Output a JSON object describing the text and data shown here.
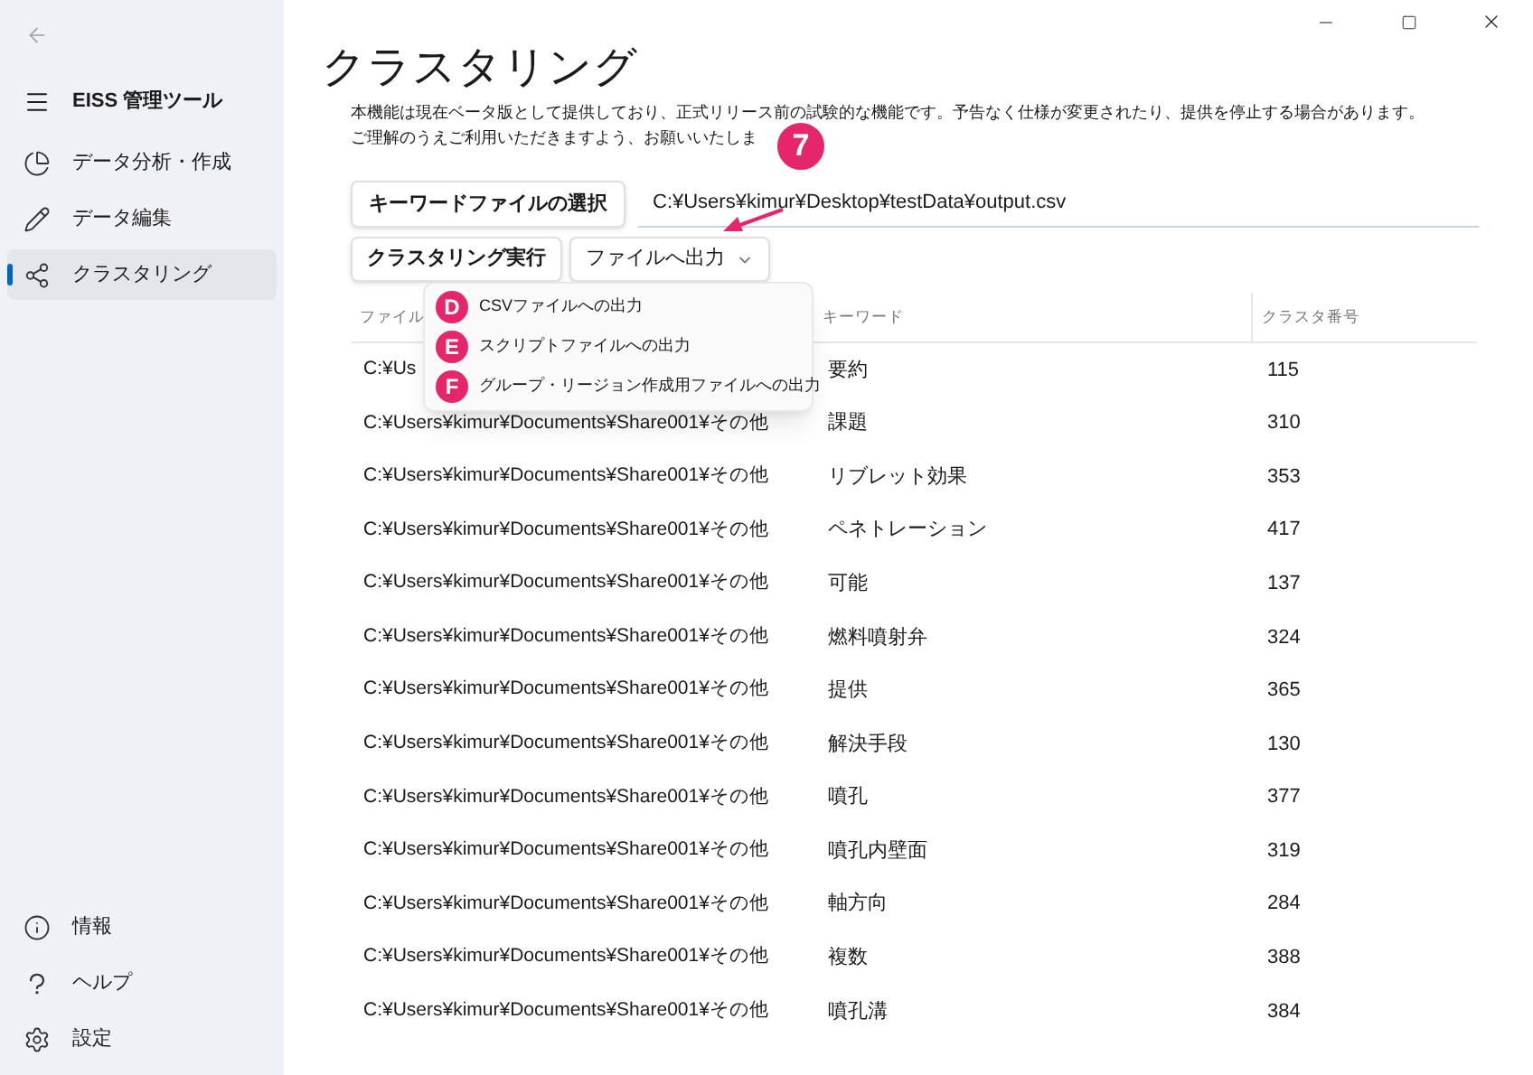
{
  "sidebar": {
    "app_title": "EISS 管理ツール",
    "nav_items": [
      {
        "kind": "chart",
        "label": "データ分析・作成",
        "selected": false
      },
      {
        "kind": "edit",
        "label": "データ編集",
        "selected": false
      },
      {
        "kind": "cluster",
        "label": "クラスタリング",
        "selected": true
      }
    ],
    "footer_items": [
      {
        "kind": "info",
        "label": "情報"
      },
      {
        "kind": "help",
        "label": "ヘルプ"
      },
      {
        "kind": "settings",
        "label": "設定"
      }
    ]
  },
  "page": {
    "title": "クラスタリング",
    "description": [
      "本機能は現在ベータ版として提供しており、正式リリース前の試験的な機能です。予告なく仕様が変更されたり、提供を停止する場合があります。",
      "ご理解のうえご利用いただきますよう、お願いいたしま"
    ],
    "select_button": "キーワードファイルの選択",
    "file_path": "C:¥Users¥kimur¥Desktop¥testData¥output.csv",
    "run_button": "クラスタリング実行",
    "export_button": "ファイルへ出力",
    "export_menu": [
      {
        "badge": "D",
        "label": "CSVファイルへの出力"
      },
      {
        "badge": "E",
        "label": "スクリプトファイルへの出力"
      },
      {
        "badge": "F",
        "label": "グループ・リージョン作成用ファイルへの出力"
      }
    ],
    "callout": "7"
  },
  "table": {
    "columns": [
      "ファイル",
      "キーワード",
      "クラスタ番号"
    ],
    "rows": [
      [
        "C:¥Us",
        "要約",
        "115"
      ],
      [
        "C:¥Users¥kimur¥Documents¥Share001¥その他",
        "課題",
        "310"
      ],
      [
        "C:¥Users¥kimur¥Documents¥Share001¥その他",
        "リブレット効果",
        "353"
      ],
      [
        "C:¥Users¥kimur¥Documents¥Share001¥その他",
        "ペネトレーション",
        "417"
      ],
      [
        "C:¥Users¥kimur¥Documents¥Share001¥その他",
        "可能",
        "137"
      ],
      [
        "C:¥Users¥kimur¥Documents¥Share001¥その他",
        "燃料噴射弁",
        "324"
      ],
      [
        "C:¥Users¥kimur¥Documents¥Share001¥その他",
        "提供",
        "365"
      ],
      [
        "C:¥Users¥kimur¥Documents¥Share001¥その他",
        "解決手段",
        "130"
      ],
      [
        "C:¥Users¥kimur¥Documents¥Share001¥その他",
        "噴孔",
        "377"
      ],
      [
        "C:¥Users¥kimur¥Documents¥Share001¥その他",
        "噴孔内壁面",
        "319"
      ],
      [
        "C:¥Users¥kimur¥Documents¥Share001¥その他",
        "軸方向",
        "284"
      ],
      [
        "C:¥Users¥kimur¥Documents¥Share001¥その他",
        "複数",
        "388"
      ],
      [
        "C:¥Users¥kimur¥Documents¥Share001¥その他",
        "噴孔溝",
        "384"
      ]
    ]
  }
}
